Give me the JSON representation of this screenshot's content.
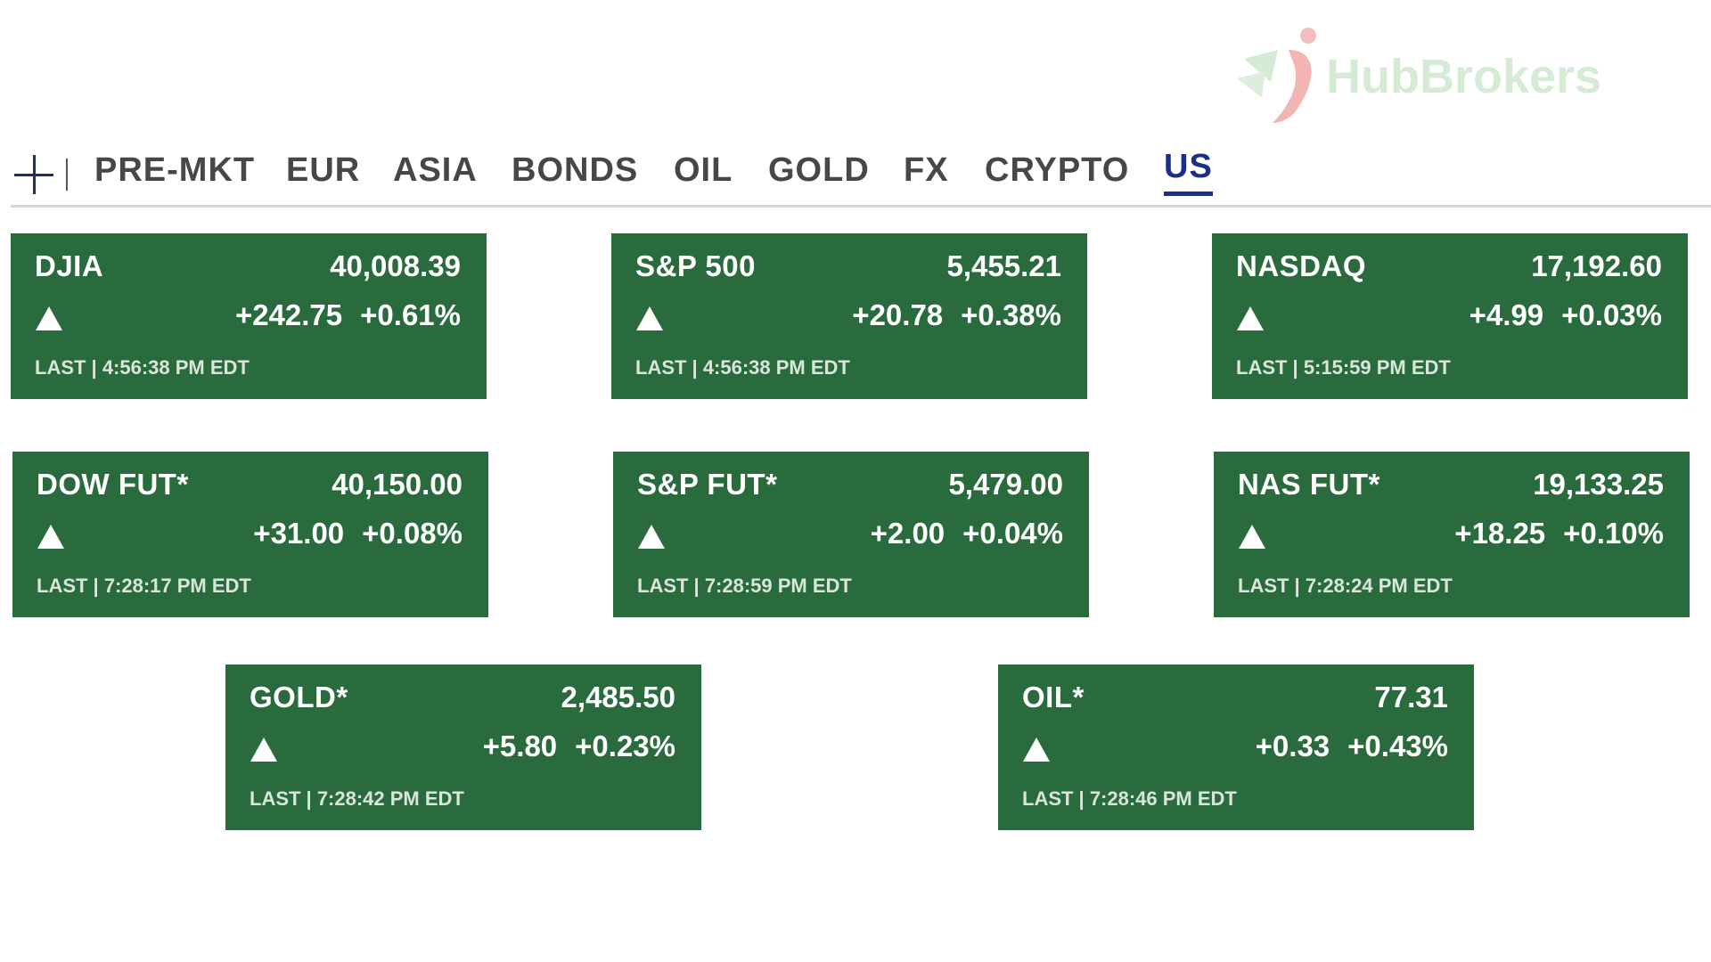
{
  "logo": {
    "text": "HubBrokers"
  },
  "tabs": [
    {
      "label": "PRE-MKT",
      "active": false
    },
    {
      "label": "EUR",
      "active": false
    },
    {
      "label": "ASIA",
      "active": false
    },
    {
      "label": "BONDS",
      "active": false
    },
    {
      "label": "OIL",
      "active": false
    },
    {
      "label": "GOLD",
      "active": false
    },
    {
      "label": "FX",
      "active": false
    },
    {
      "label": "CRYPTO",
      "active": false
    },
    {
      "label": "US",
      "active": true
    }
  ],
  "colors": {
    "card_bg": "#2a6b3e",
    "active_tab": "#1b2f8a",
    "tab_text": "#474747"
  },
  "cards": [
    {
      "name": "DJIA",
      "price": "40,008.39",
      "change": "+242.75",
      "pct": "+0.61%",
      "time": "LAST | 4:56:38 PM EDT",
      "direction": "up"
    },
    {
      "name": "S&P 500",
      "price": "5,455.21",
      "change": "+20.78",
      "pct": "+0.38%",
      "time": "LAST | 4:56:38 PM EDT",
      "direction": "up"
    },
    {
      "name": "NASDAQ",
      "price": "17,192.60",
      "change": "+4.99",
      "pct": "+0.03%",
      "time": "LAST | 5:15:59 PM EDT",
      "direction": "up"
    },
    {
      "name": "DOW FUT*",
      "price": "40,150.00",
      "change": "+31.00",
      "pct": "+0.08%",
      "time": "LAST | 7:28:17 PM EDT",
      "direction": "up"
    },
    {
      "name": "S&P FUT*",
      "price": "5,479.00",
      "change": "+2.00",
      "pct": "+0.04%",
      "time": "LAST | 7:28:59 PM EDT",
      "direction": "up"
    },
    {
      "name": "NAS FUT*",
      "price": "19,133.25",
      "change": "+18.25",
      "pct": "+0.10%",
      "time": "LAST | 7:28:24 PM EDT",
      "direction": "up"
    },
    {
      "name": "GOLD*",
      "price": "2,485.50",
      "change": "+5.80",
      "pct": "+0.23%",
      "time": "LAST | 7:28:42 PM EDT",
      "direction": "up"
    },
    {
      "name": "OIL*",
      "price": "77.31",
      "change": "+0.33",
      "pct": "+0.43%",
      "time": "LAST | 7:28:46 PM EDT",
      "direction": "up"
    }
  ]
}
